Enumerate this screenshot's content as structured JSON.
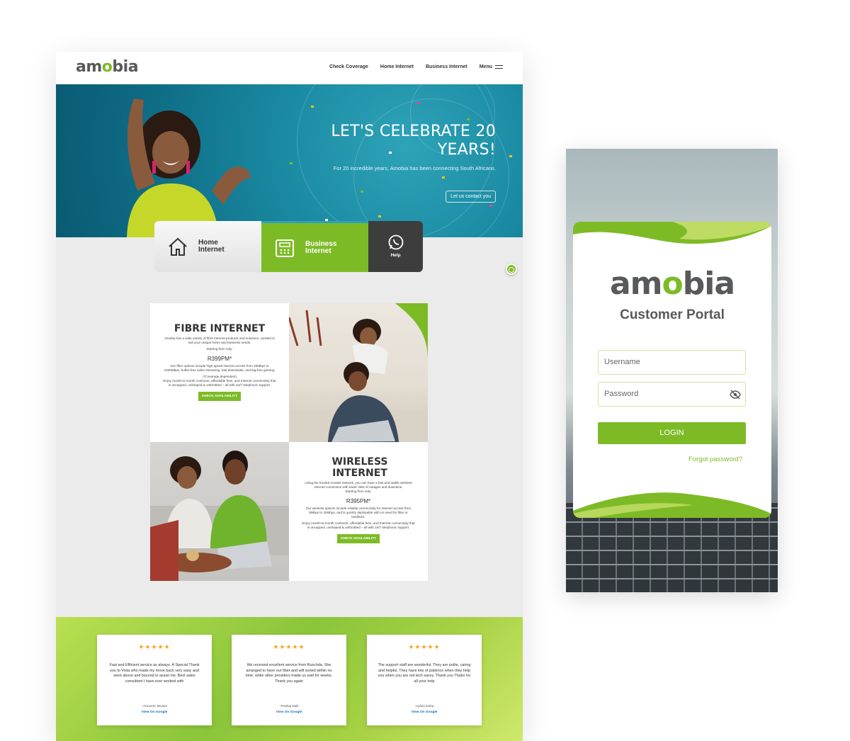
{
  "site": {
    "logo": {
      "pre": "am",
      "o": "o",
      "post": "bia"
    },
    "nav": [
      "Check Coverage",
      "Home Internet",
      "Business Internet",
      "Menu"
    ],
    "hero": {
      "title": "LET'S CELEBRATE 20 YEARS!",
      "subtitle": "For 20 incredible years, Amobia has been connecting South Africans.",
      "button": "Let us contact you"
    },
    "tiles": {
      "home": "Home Internet",
      "business": "Business Internet",
      "help": "Help"
    },
    "products": {
      "fibre": {
        "title": "FIBRE INTERNET",
        "desc": "Amobia has a wide variety of fibre Internet products and solutions, curated to suit your unique home and business needs.",
        "starting": "Starting from only:",
        "price": "R399PM*",
        "detail_a": "Our fibre options include high-speed internet access from 20Mbps to 1000Mbps, buffer-free video streaming, fast downloads, and lag-free gaming.",
        "coverage": "(*Coverage dependent)",
        "detail_b": "Enjoy month-to-month contracts, affordable fees, and Internet connectivity that is uncapped, unshaped & unthrottled – all with 24/7 telephonic support.",
        "button": "CHECK AVAILABILITY"
      },
      "wireless": {
        "title": "WIRELESS INTERNET",
        "desc": "Using the trusted Amobia network, you can have a fast and stable wireless internet connection with lower risks of outages and downtime.",
        "starting": "Starting from only:",
        "price": "R395PM*",
        "detail_a": "Our wireless options include reliable connectivity for Internet access from 8Mbps to 20Mbps, and is quickly deployable with no need for fibre or landlines.",
        "detail_b": "Enjoy month-to-month contracts, affordable fees, and Internet connectivity that is uncapped, unshaped & unthrottled – all with 24/7 telephonic support.",
        "button": "CHECK AVAILABILITY"
      }
    },
    "reviews": [
      {
        "stars": "★★★★★",
        "text": "Fast and Efficient service as always. A Special Thank you to Vista who made my move back very easy and went above and beyond to assist me. Best sales consultant I have ever worked with",
        "author": "~Anneme' Bruwer",
        "link": "View On Google"
      },
      {
        "stars": "★★★★★",
        "text": "We received excellent service from Ruschda. She arranged to have our fiber and wifi sorted within no time, while other providers made us wait for weeks. Thank you again",
        "author": "~Pankaj Naik",
        "link": "View On Google"
      },
      {
        "stars": "★★★★★",
        "text": "The support staff are wonderful. They are polite, caring and helpful. They have lots of patience when they help you when you are not tech savvy. Thank you Thabo for all your help",
        "author": "~sylvia botha",
        "link": "View On Google"
      }
    ]
  },
  "portal": {
    "logo": {
      "pre": "am",
      "o": "o",
      "post": "bia"
    },
    "subtitle": "Customer Portal",
    "username_placeholder": "Username",
    "password_placeholder": "Password",
    "login_button": "LOGIN",
    "forgot": "Forgot password?"
  },
  "colors": {
    "brand_green": "#7dbb26",
    "logo_grey": "#58595b",
    "hero_teal": "#1a8aa2",
    "star": "#f5a623"
  },
  "icons": [
    "house-icon",
    "fax-icon",
    "whatsapp-icon",
    "eye-off-icon",
    "menu-icon"
  ]
}
